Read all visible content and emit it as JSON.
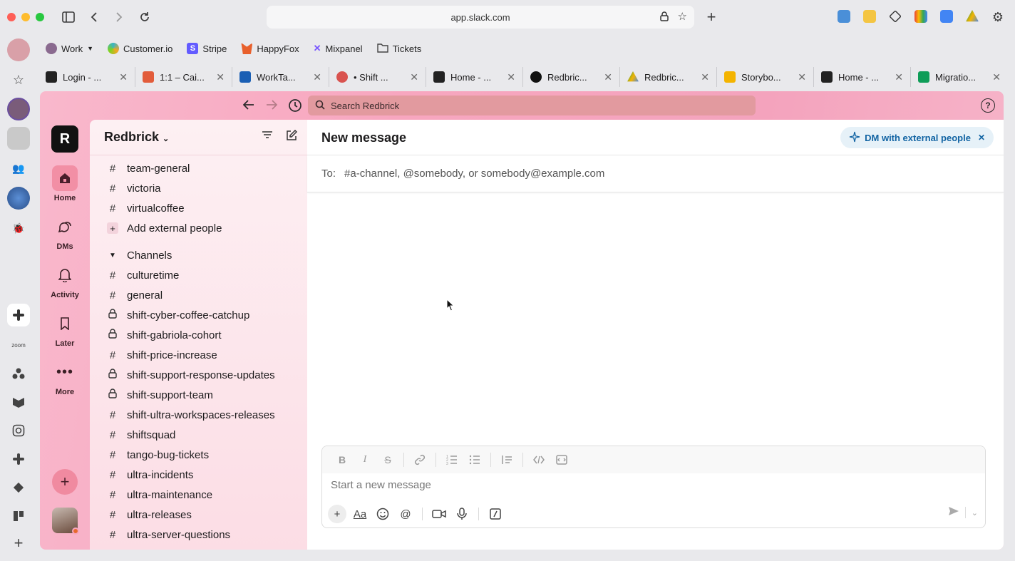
{
  "browser": {
    "url": "app.slack.com",
    "bookmarks": [
      {
        "label": "Work",
        "color": "#8a6a8f"
      },
      {
        "label": "Customer.io",
        "color": "#39b5c7"
      },
      {
        "label": "Stripe",
        "color": "#635bff"
      },
      {
        "label": "HappyFox",
        "color": "#e8602c"
      },
      {
        "label": "Mixpanel",
        "color": "#7856ff"
      },
      {
        "label": "Tickets",
        "color": "#ffffff"
      }
    ],
    "tabs": [
      {
        "title": "Login - ...",
        "color": "#222222"
      },
      {
        "title": "1:1 – Cai...",
        "color": "#e25c3b"
      },
      {
        "title": "WorkTa...",
        "color": "#1a5fb4"
      },
      {
        "title": "• Shift ...",
        "color": "#d9534f"
      },
      {
        "title": "Home - ...",
        "color": "#222222"
      },
      {
        "title": "Redbric...",
        "color": "#111111"
      },
      {
        "title": "Redbric...",
        "color": "#34a853"
      },
      {
        "title": "Storybo...",
        "color": "#f4b400"
      },
      {
        "title": "Home - ...",
        "color": "#222222"
      },
      {
        "title": "Migratio...",
        "color": "#0f9d58"
      }
    ]
  },
  "slack": {
    "search_placeholder": "Search Redbrick",
    "workspace_initial": "R",
    "rail": [
      {
        "label": "Home",
        "icon": "home-icon"
      },
      {
        "label": "DMs",
        "icon": "dms-icon"
      },
      {
        "label": "Activity",
        "icon": "bell-icon"
      },
      {
        "label": "Later",
        "icon": "bookmark-icon"
      },
      {
        "label": "More",
        "icon": "more-icon"
      }
    ],
    "sidebar": {
      "workspace_name": "Redbrick",
      "top_items": [
        {
          "label": "team-general",
          "type": "hash"
        },
        {
          "label": "victoria",
          "type": "hash"
        },
        {
          "label": "virtualcoffee",
          "type": "hash"
        }
      ],
      "add_external": "Add external people",
      "channels_section": "Channels",
      "channels": [
        {
          "label": "culturetime",
          "type": "hash"
        },
        {
          "label": "general",
          "type": "hash"
        },
        {
          "label": "shift-cyber-coffee-catchup",
          "type": "lock"
        },
        {
          "label": "shift-gabriola-cohort",
          "type": "lock"
        },
        {
          "label": "shift-price-increase",
          "type": "hash"
        },
        {
          "label": "shift-support-response-updates",
          "type": "lock"
        },
        {
          "label": "shift-support-team",
          "type": "lock"
        },
        {
          "label": "shift-ultra-workspaces-releases",
          "type": "hash"
        },
        {
          "label": "shiftsquad",
          "type": "hash"
        },
        {
          "label": "tango-bug-tickets",
          "type": "hash"
        },
        {
          "label": "ultra-incidents",
          "type": "hash"
        },
        {
          "label": "ultra-maintenance",
          "type": "hash"
        },
        {
          "label": "ultra-releases",
          "type": "hash"
        },
        {
          "label": "ultra-server-questions",
          "type": "hash"
        }
      ]
    },
    "main": {
      "title": "New message",
      "dm_pill": "DM with external people",
      "to_label": "To:",
      "to_placeholder": "#a-channel, @somebody, or somebody@example.com",
      "message_placeholder": "Start a new message"
    }
  }
}
